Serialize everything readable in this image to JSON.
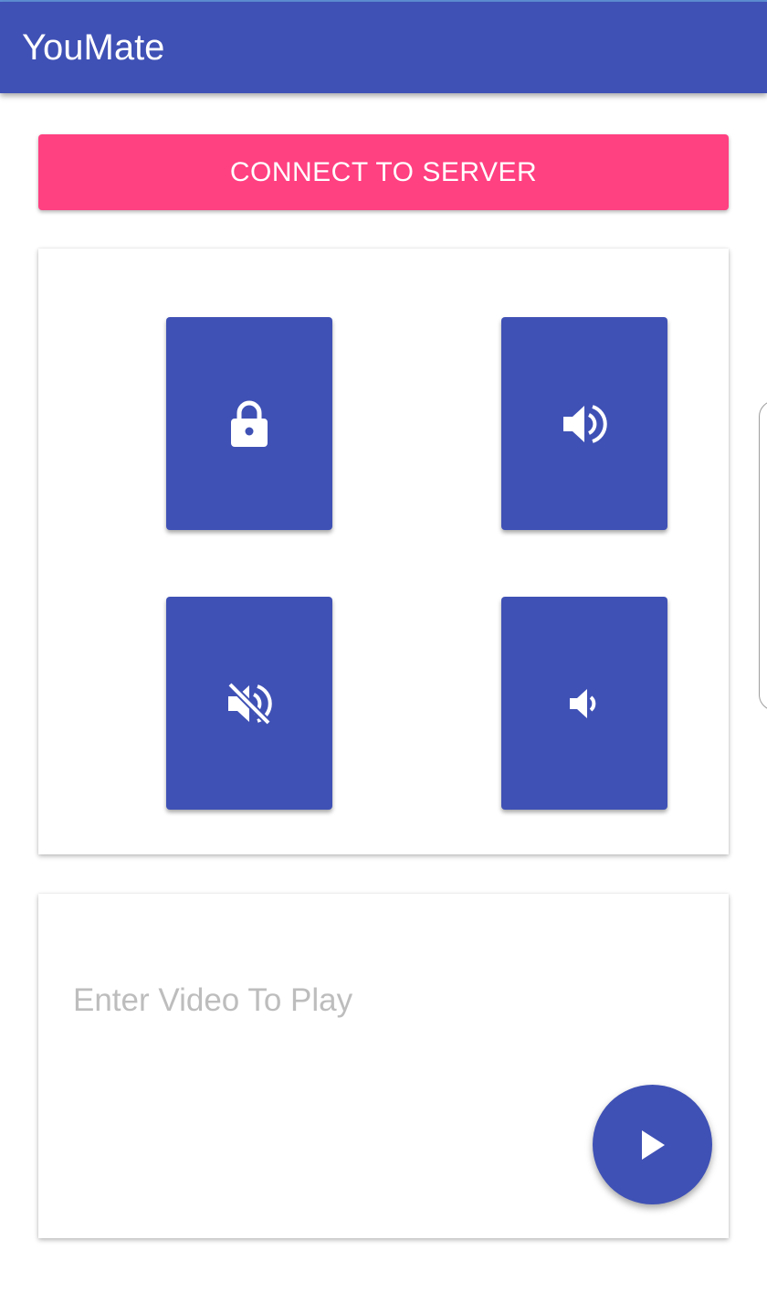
{
  "app": {
    "title": "YouMate"
  },
  "connect": {
    "label": "CONNECT TO SERVER"
  },
  "controls": {
    "tiles": [
      {
        "icon": "lock-icon"
      },
      {
        "icon": "volume-up-icon"
      },
      {
        "icon": "volume-off-icon"
      },
      {
        "icon": "volume-down-icon"
      }
    ]
  },
  "video": {
    "placeholder": "Enter Video To Play",
    "value": "",
    "play_icon": "play-icon"
  },
  "colors": {
    "primary": "#3f51b5",
    "accent": "#ff4081",
    "background": "#ffffff",
    "hint": "#bdbdbd"
  }
}
